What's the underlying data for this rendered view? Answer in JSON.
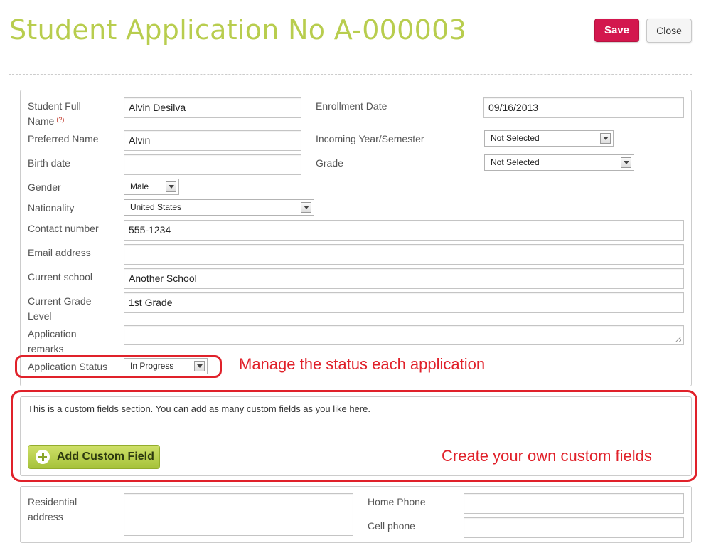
{
  "header": {
    "title": "Student Application No A-000003",
    "save_label": "Save",
    "close_label": "Close"
  },
  "form": {
    "student_full_name": {
      "label1": "Student Full",
      "label2": "Name",
      "help": "(?)",
      "value": "Alvin Desilva"
    },
    "enrollment_date": {
      "label": "Enrollment Date",
      "value": "09/16/2013"
    },
    "preferred_name": {
      "label": "Preferred Name",
      "value": "Alvin"
    },
    "incoming_year": {
      "label": "Incoming Year/Semester",
      "value": "Not Selected"
    },
    "birth_date": {
      "label": "Birth date",
      "value": ""
    },
    "grade": {
      "label": "Grade",
      "value": "Not Selected"
    },
    "gender": {
      "label": "Gender",
      "value": "Male"
    },
    "nationality": {
      "label": "Nationality",
      "value": "United States"
    },
    "contact_number": {
      "label": "Contact number",
      "value": "555-1234"
    },
    "email_address": {
      "label": "Email address",
      "value": ""
    },
    "current_school": {
      "label": "Current school",
      "value": "Another School"
    },
    "current_grade_level": {
      "label1": "Current Grade",
      "label2": "Level",
      "value": "1st Grade"
    },
    "application_remarks": {
      "label1": "Application",
      "label2": "remarks",
      "value": ""
    },
    "application_status": {
      "label": "Application Status",
      "value": "In Progress"
    }
  },
  "custom_fields": {
    "description": "This is a custom fields section. You can add as many custom fields as you like here.",
    "add_button_label": "Add Custom Field"
  },
  "annotations": {
    "status_note": "Manage the status each application",
    "custom_note": "Create your own custom fields"
  },
  "address_section": {
    "residential_address": {
      "label1": "Residential",
      "label2": "address",
      "value": ""
    },
    "home_phone": {
      "label": "Home Phone",
      "value": ""
    },
    "cell_phone": {
      "label": "Cell phone",
      "value": ""
    }
  },
  "colors": {
    "title": "#b8cd4e",
    "save_button": "#d3174e",
    "annotation": "#e0212a",
    "add_button": "#a6c23a"
  }
}
